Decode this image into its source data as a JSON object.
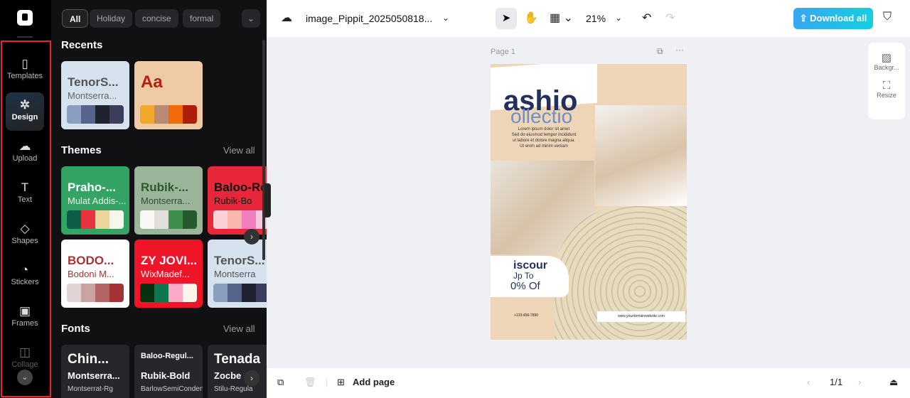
{
  "rail": {
    "items": [
      {
        "label": "Templates",
        "icon": "templates-icon",
        "glyph": "▯"
      },
      {
        "label": "Design",
        "icon": "design-icon",
        "glyph": "✲"
      },
      {
        "label": "Upload",
        "icon": "upload-cloud-icon",
        "glyph": "☁"
      },
      {
        "label": "Text",
        "icon": "text-icon",
        "glyph": "T"
      },
      {
        "label": "Shapes",
        "icon": "shapes-icon",
        "glyph": "◇"
      },
      {
        "label": "Stickers",
        "icon": "sticker-icon",
        "glyph": "◔"
      },
      {
        "label": "Frames",
        "icon": "frame-icon",
        "glyph": "▣"
      },
      {
        "label": "Collage",
        "icon": "collage-icon",
        "glyph": "◫"
      }
    ],
    "active": "Design"
  },
  "panel": {
    "chips": [
      "All",
      "Holiday",
      "concise",
      "formal"
    ],
    "recents_title": "Recents",
    "themes_title": "Themes",
    "fonts_title": "Fonts",
    "view_all": "View all",
    "recents": [
      {
        "t1": "TenorS...",
        "t2": "Montserra...",
        "bg": "#d6e2ee",
        "c1": "#555",
        "colors": [
          "#8a9ec0",
          "#56638a",
          "#20222f",
          "#3c3d5c"
        ]
      },
      {
        "t1": "Aa",
        "t2": "",
        "bg": "#eecaa5",
        "c1": "#b2200f",
        "colors": [
          "#f2a82a",
          "#bb8a72",
          "#f26a0a",
          "#b01c0a"
        ]
      }
    ],
    "themes": [
      {
        "t1": "Praho-...",
        "t2": "Mulat Addis-...",
        "bg": "#33a466",
        "c1": "#fff",
        "c2": "#e8f2e6",
        "colors": [
          "#0d5e48",
          "#e8323c",
          "#edd49a",
          "#f8f6ea"
        ]
      },
      {
        "t1": "Rubik-...",
        "t2": "Montserra...",
        "bg": "#9bb59b",
        "c1": "#2b5a2f",
        "c2": "#2f4a30",
        "colors": [
          "#faf8f5",
          "#e2dfda",
          "#3f8e4c",
          "#265a2c"
        ]
      },
      {
        "t1": "Baloo-Regu",
        "t2": "Rubik-Bo",
        "bg": "#e8283a",
        "c1": "#111",
        "c2": "#111",
        "colors": [
          "#fdd0d6",
          "#fbb7ad",
          "#f27fbd",
          "#f6c7df"
        ]
      },
      {
        "t1": "BODO...",
        "t2": "Bodoni M...",
        "bg": "#ffffff",
        "c1": "#a83236",
        "c2": "#a83236",
        "colors": [
          "#e2d4d4",
          "#c9a4a3",
          "#b36464",
          "#a33336"
        ]
      },
      {
        "t1": "ZY JOVI...",
        "t2": "WixMadef...",
        "bg": "#ee1528",
        "c1": "#fff",
        "c2": "#fff",
        "colors": [
          "#08320f",
          "#0b7650",
          "#fca8c8",
          "#fbf5ea"
        ]
      },
      {
        "t1": "TenorS...",
        "t2": "Montserra",
        "bg": "#d6e2ee",
        "c1": "#555",
        "c2": "#555",
        "colors": [
          "#8a9ec0",
          "#56638a",
          "#20222f",
          "#3c3d5c"
        ]
      }
    ],
    "fonts": [
      {
        "t1": "Chin...",
        "t2": "Montserra...",
        "t3": "Montserrat-Rg"
      },
      {
        "t1": "Baloo-Regul...",
        "t2": "Rubik-Bold",
        "t3": "BarlowSemiConden..."
      },
      {
        "t1": "Tenada",
        "t2": "Zocbe",
        "t3": "Stilu-Regula"
      }
    ]
  },
  "topbar": {
    "filename": "image_Pippit_2025050818...",
    "zoom": "21%",
    "download": "Download all"
  },
  "canvas": {
    "page_label": "Page 1",
    "side_tools": [
      "Backgr...",
      "Resize"
    ],
    "poster": {
      "title": "ashio",
      "subtitle": "ollectio",
      "body": "Lorem ipsum dolor sit amet\nSed do eiusmod tempor incididunt\nut labore et dolore magna aliqua.\nUt enim ad minim veniam",
      "discount1": "iscour",
      "discount2": "Jp To",
      "discount3": "0% Of",
      "phone": "+123-456-7890",
      "website": "www.yourdomainwebsite.com"
    }
  },
  "bottombar": {
    "add_page": "Add page",
    "pages": "1/1"
  }
}
